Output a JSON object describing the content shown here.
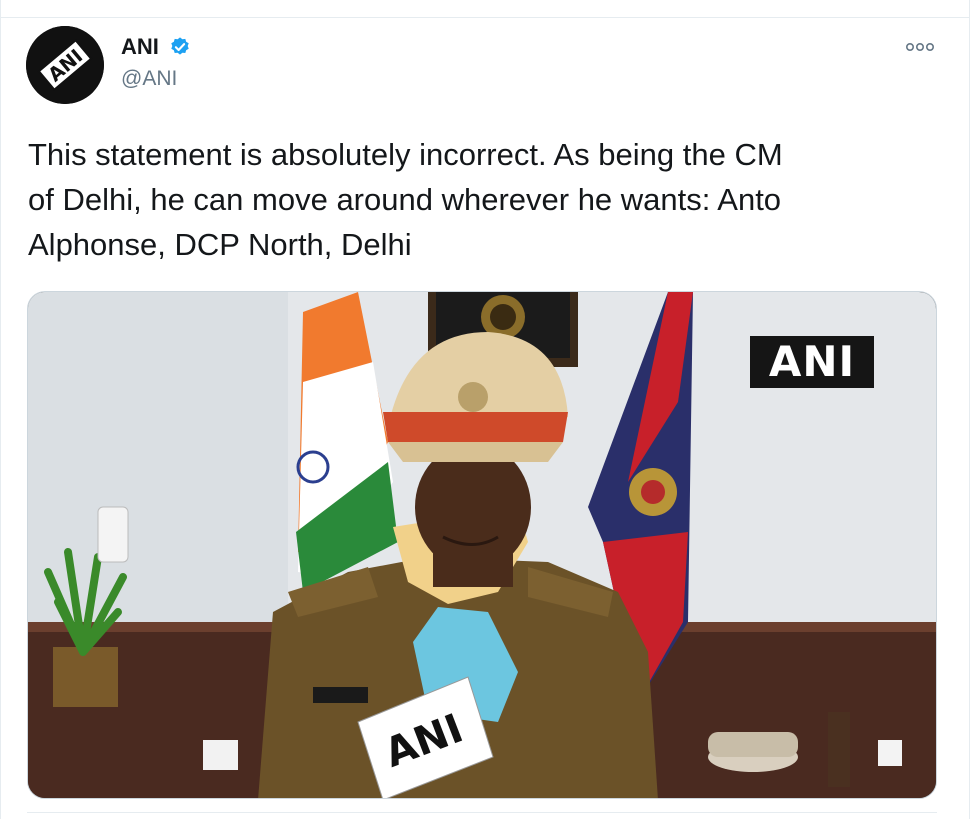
{
  "author": {
    "name": "ANI",
    "handle": "@ANI",
    "verified": true,
    "avatar_text": "ANI"
  },
  "tweet": {
    "text_line_1": "This statement is absolutely incorrect. As being the CM",
    "text_line_2": "of Delhi, he can move around wherever he wants: Anto",
    "text_line_3": "Alphonse, DCP North, Delhi"
  },
  "media": {
    "watermark": "ANI",
    "mic_label": "ANI"
  },
  "icons": {
    "verified": "verified-badge-icon",
    "more": "more-options-icon"
  },
  "colors": {
    "verified_blue": "#1da1f2",
    "text": "#14171a",
    "muted": "#657786"
  }
}
